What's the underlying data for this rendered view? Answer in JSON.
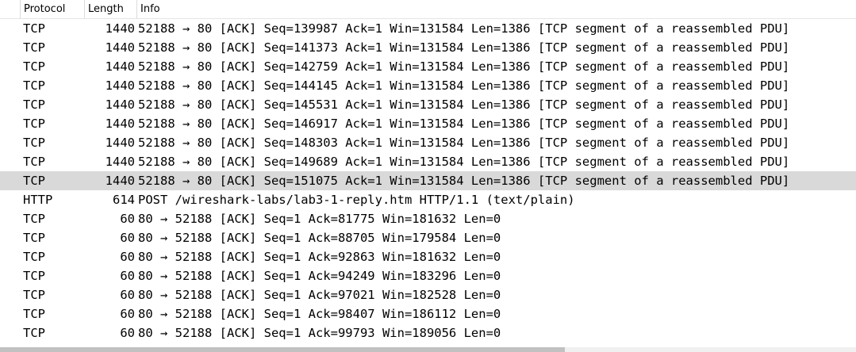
{
  "header": {
    "protocol": "Protocol",
    "length": "Length",
    "info": "Info"
  },
  "selected_row": 8,
  "scrollbar": {
    "thumb_fraction": 0.66
  },
  "rows": [
    {
      "protocol": "TCP",
      "length": "1440",
      "info": "52188 → 80 [ACK] Seq=139987 Ack=1 Win=131584 Len=1386 [TCP segment of a reassembled PDU]"
    },
    {
      "protocol": "TCP",
      "length": "1440",
      "info": "52188 → 80 [ACK] Seq=141373 Ack=1 Win=131584 Len=1386 [TCP segment of a reassembled PDU]"
    },
    {
      "protocol": "TCP",
      "length": "1440",
      "info": "52188 → 80 [ACK] Seq=142759 Ack=1 Win=131584 Len=1386 [TCP segment of a reassembled PDU]"
    },
    {
      "protocol": "TCP",
      "length": "1440",
      "info": "52188 → 80 [ACK] Seq=144145 Ack=1 Win=131584 Len=1386 [TCP segment of a reassembled PDU]"
    },
    {
      "protocol": "TCP",
      "length": "1440",
      "info": "52188 → 80 [ACK] Seq=145531 Ack=1 Win=131584 Len=1386 [TCP segment of a reassembled PDU]"
    },
    {
      "protocol": "TCP",
      "length": "1440",
      "info": "52188 → 80 [ACK] Seq=146917 Ack=1 Win=131584 Len=1386 [TCP segment of a reassembled PDU]"
    },
    {
      "protocol": "TCP",
      "length": "1440",
      "info": "52188 → 80 [ACK] Seq=148303 Ack=1 Win=131584 Len=1386 [TCP segment of a reassembled PDU]"
    },
    {
      "protocol": "TCP",
      "length": "1440",
      "info": "52188 → 80 [ACK] Seq=149689 Ack=1 Win=131584 Len=1386 [TCP segment of a reassembled PDU]"
    },
    {
      "protocol": "TCP",
      "length": "1440",
      "info": "52188 → 80 [ACK] Seq=151075 Ack=1 Win=131584 Len=1386 [TCP segment of a reassembled PDU]"
    },
    {
      "protocol": "HTTP",
      "length": "614",
      "info": "POST /wireshark-labs/lab3-1-reply.htm HTTP/1.1  (text/plain)"
    },
    {
      "protocol": "TCP",
      "length": "60",
      "info": "80 → 52188 [ACK] Seq=1 Ack=81775 Win=181632 Len=0"
    },
    {
      "protocol": "TCP",
      "length": "60",
      "info": "80 → 52188 [ACK] Seq=1 Ack=88705 Win=179584 Len=0"
    },
    {
      "protocol": "TCP",
      "length": "60",
      "info": "80 → 52188 [ACK] Seq=1 Ack=92863 Win=181632 Len=0"
    },
    {
      "protocol": "TCP",
      "length": "60",
      "info": "80 → 52188 [ACK] Seq=1 Ack=94249 Win=183296 Len=0"
    },
    {
      "protocol": "TCP",
      "length": "60",
      "info": "80 → 52188 [ACK] Seq=1 Ack=97021 Win=182528 Len=0"
    },
    {
      "protocol": "TCP",
      "length": "60",
      "info": "80 → 52188 [ACK] Seq=1 Ack=98407 Win=186112 Len=0"
    },
    {
      "protocol": "TCP",
      "length": "60",
      "info": "80 → 52188 [ACK] Seq=1 Ack=99793 Win=189056 Len=0"
    }
  ]
}
